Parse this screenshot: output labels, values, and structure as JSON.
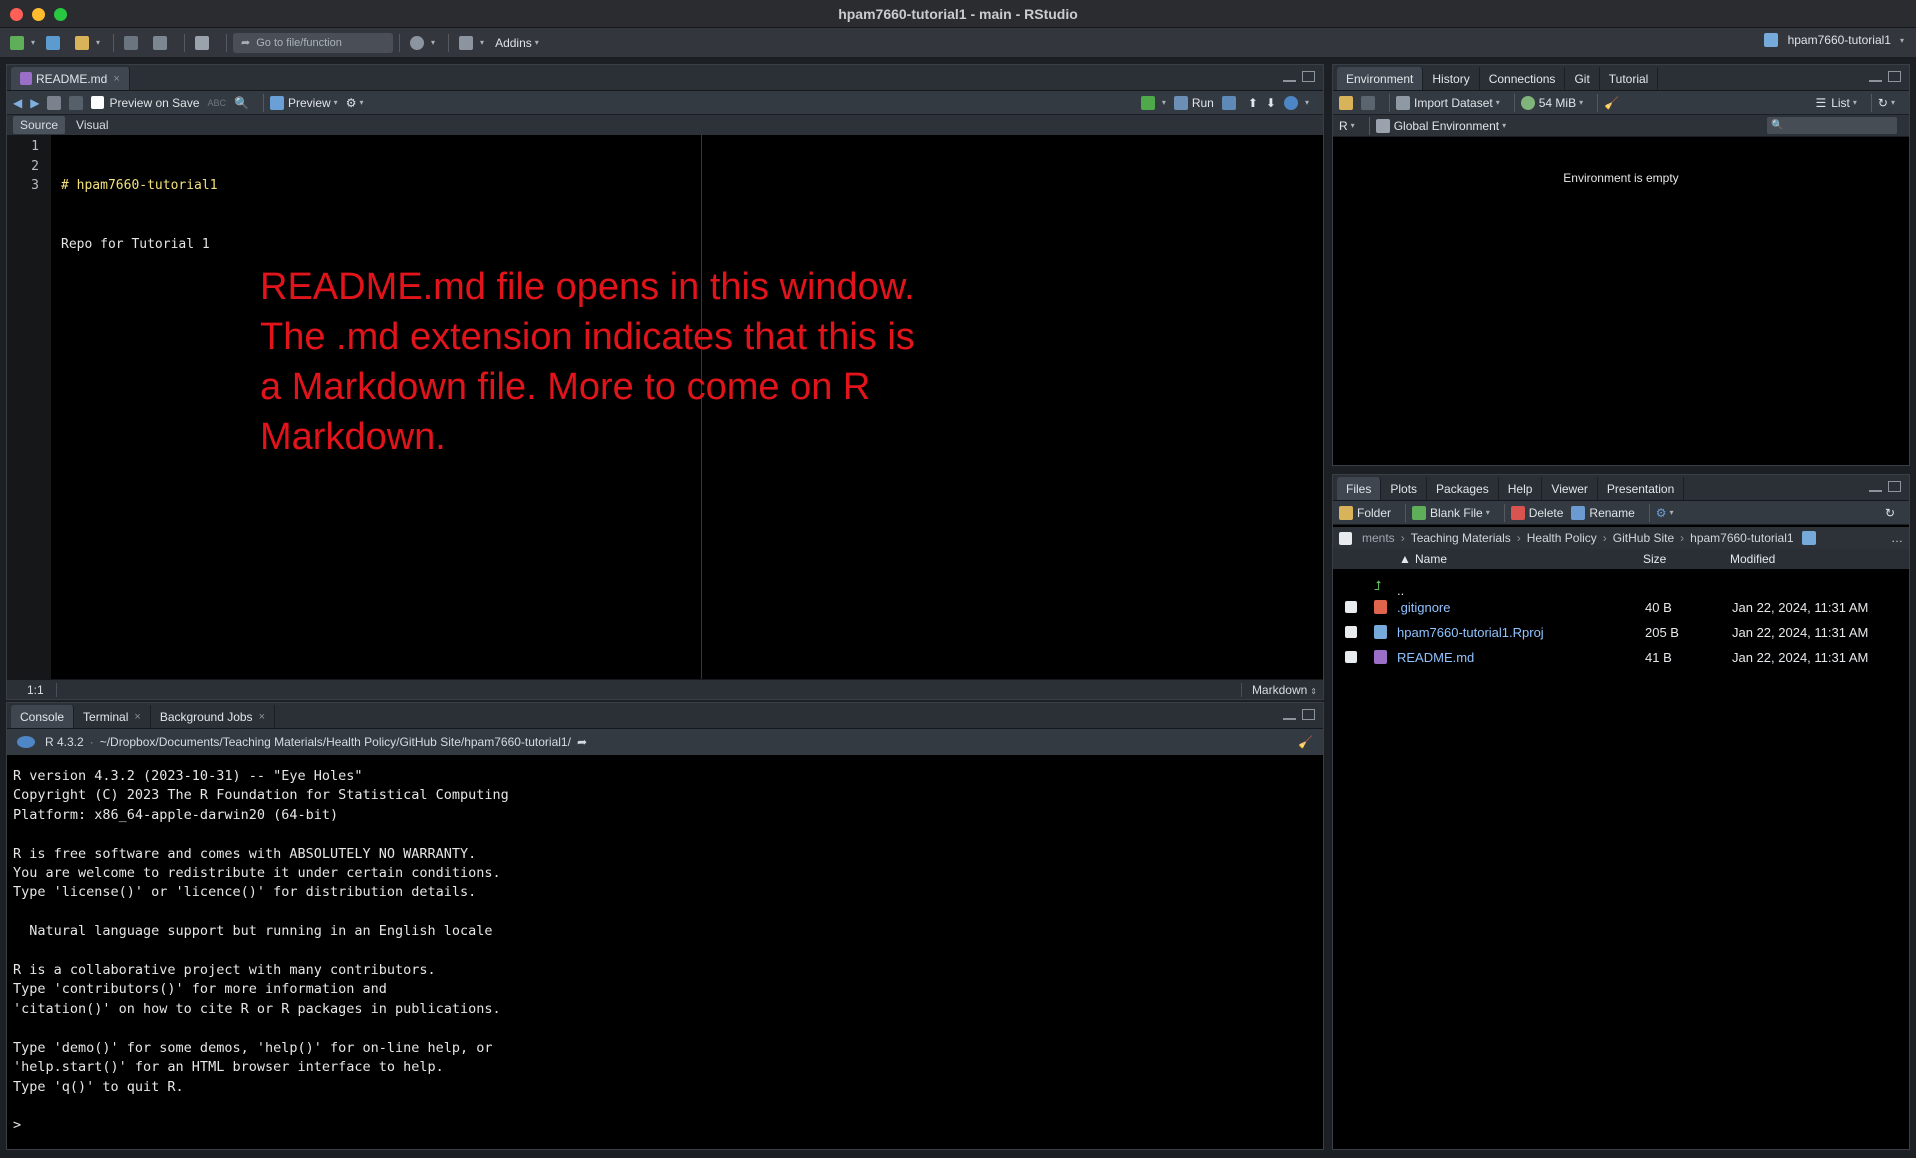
{
  "window": {
    "title": "hpam7660-tutorial1 - main - RStudio"
  },
  "main_toolbar": {
    "goto_placeholder": "Go to file/function",
    "addins": "Addins",
    "project": "hpam7660-tutorial1"
  },
  "source_pane": {
    "tab": "README.md",
    "preview_on_save": "Preview on Save",
    "preview": "Preview",
    "run": "Run",
    "mode_source": "Source",
    "mode_visual": "Visual",
    "line_numbers": [
      "1",
      "2",
      "3"
    ],
    "code_lines": [
      "# hpam7660-tutorial1",
      "Repo for Tutorial 1",
      ""
    ],
    "cursor_pos": "1:1",
    "file_type": "Markdown",
    "annotation": "README.md file opens in this window. The .md extension indicates that this is a Markdown file. More to come on R Markdown."
  },
  "console_pane": {
    "tabs": [
      "Console",
      "Terminal",
      "Background Jobs"
    ],
    "r_version": "R 4.3.2",
    "path": "~/Dropbox/Documents/Teaching Materials/Health Policy/GitHub Site/hpam7660-tutorial1/",
    "output": "R version 4.3.2 (2023-10-31) -- \"Eye Holes\"\nCopyright (C) 2023 The R Foundation for Statistical Computing\nPlatform: x86_64-apple-darwin20 (64-bit)\n\nR is free software and comes with ABSOLUTELY NO WARRANTY.\nYou are welcome to redistribute it under certain conditions.\nType 'license()' or 'licence()' for distribution details.\n\n  Natural language support but running in an English locale\n\nR is a collaborative project with many contributors.\nType 'contributors()' for more information and\n'citation()' on how to cite R or R packages in publications.\n\nType 'demo()' for some demos, 'help()' for on-line help, or\n'help.start()' for an HTML browser interface to help.\nType 'q()' to quit R.\n\n>"
  },
  "env_pane": {
    "tabs": [
      "Environment",
      "History",
      "Connections",
      "Git",
      "Tutorial"
    ],
    "import_dataset": "Import Dataset",
    "memory": "54 MiB",
    "list": "List",
    "lang": "R",
    "scope": "Global Environment",
    "empty_msg": "Environment is empty"
  },
  "files_pane": {
    "tabs": [
      "Files",
      "Plots",
      "Packages",
      "Help",
      "Viewer",
      "Presentation"
    ],
    "folder": "Folder",
    "blank_file": "Blank File",
    "delete": "Delete",
    "rename": "Rename",
    "breadcrumb": [
      "ments",
      "Teaching Materials",
      "Health Policy",
      "GitHub Site",
      "hpam7660-tutorial1"
    ],
    "col_name": "Name",
    "col_size": "Size",
    "col_modified": "Modified",
    "up": "..",
    "files": [
      {
        "name": ".gitignore",
        "size": "40 B",
        "modified": "Jan 22, 2024, 11:31 AM"
      },
      {
        "name": "hpam7660-tutorial1.Rproj",
        "size": "205 B",
        "modified": "Jan 22, 2024, 11:31 AM"
      },
      {
        "name": "README.md",
        "size": "41 B",
        "modified": "Jan 22, 2024, 11:31 AM"
      }
    ]
  },
  "colors": {
    "accent": "#75aadb",
    "annotation": "#e0141a"
  }
}
